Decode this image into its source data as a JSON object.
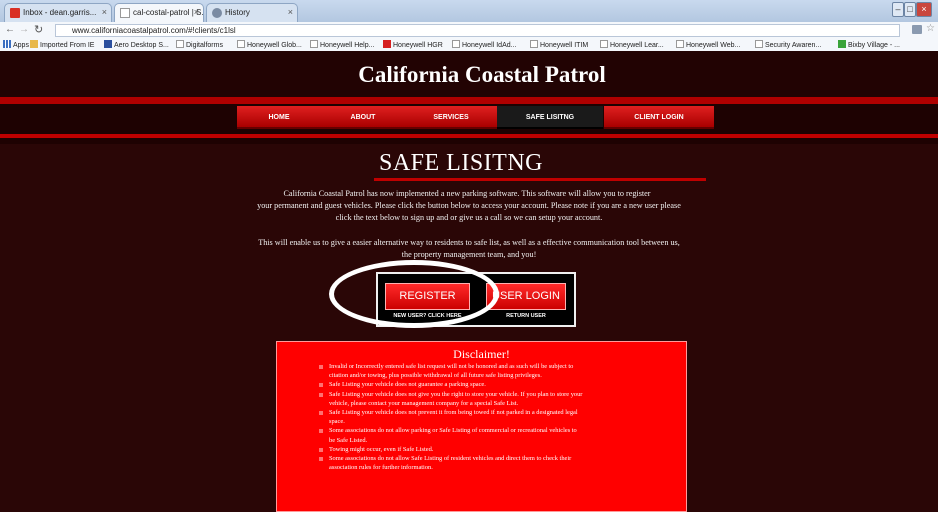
{
  "browser": {
    "tabs": [
      {
        "label": "Inbox - dean.garris..."
      },
      {
        "label": "cal-costal-patrol | S..."
      },
      {
        "label": "History"
      }
    ],
    "url": "www.californiacoastalpatrol.com/#!clients/c1lsl",
    "bookmarks": [
      "Apps",
      "Imported From IE",
      "Aero Desktop S...",
      "Digitalforms",
      "Honeywell Glob...",
      "Honeywell Help...",
      "Honeywell HGR",
      "Honeywell IdAd...",
      "Honeywell ITIM",
      "Honeywell Lear...",
      "Honeywell Web...",
      "Security Awaren...",
      "Bixby Village - ..."
    ]
  },
  "site": {
    "title": "California Coastal Patrol",
    "nav": [
      "HOME",
      "ABOUT",
      "SERVICES",
      "SAFE LISITNG",
      "CLIENT LOGIN"
    ],
    "active_nav": "SAFE LISITNG"
  },
  "page": {
    "heading": "SAFE LISITNG",
    "intro_lines": [
      "California Coastal Patrol has now implemented a new parking software. This software will allow you to register",
      "your permanent and guest vehicles. Please click the button below to access your account. Please note if you are a new user  please",
      "click the text below to sign up and or give us a call so we can setup your account."
    ],
    "benefit_lines": [
      "This will enable us to give a easier alternative way to residents to safe list, as well as a effective communication tool between us,",
      "the property management team, and you!"
    ],
    "register_label": "REGISTER",
    "register_caption": "NEW USER? CLICK HERE",
    "login_label": "USER LOGIN",
    "login_caption": "RETURN USER"
  },
  "disclaimer": {
    "title": "Disclaimer!",
    "lines": [
      "Invalid or Incorrectly entered safe list request will not be honored and as such will be subject to",
      "citation and/or towing, plus possible withdrawal of all future safe listing privileges.",
      "Safe Listing your vehicle does not guarantee a parking space.",
      "Safe Listing your vehicle does not give you the right to store your vehicle. If you plan to store your",
      "vehicle, please contact your management company for a special Safe List.",
      "Safe Listing your vehicle does not prevent it from being towed if not parked in a designated legal",
      "space.",
      "Some associations do not allow parking or Safe Listing of commercial or recreational vehicles to",
      "be Safe Listed.",
      "Towing might occur, even if Safe Listed.",
      "Some associations do not allow Safe Listing of resident vehicles and direct them to check their",
      "association rules for further information."
    ]
  },
  "colors": {
    "site_bg": "#2a0606",
    "accent_red": "#c00000",
    "button_red": "#ff1a1a",
    "disclaimer_bg": "#ff0000"
  }
}
